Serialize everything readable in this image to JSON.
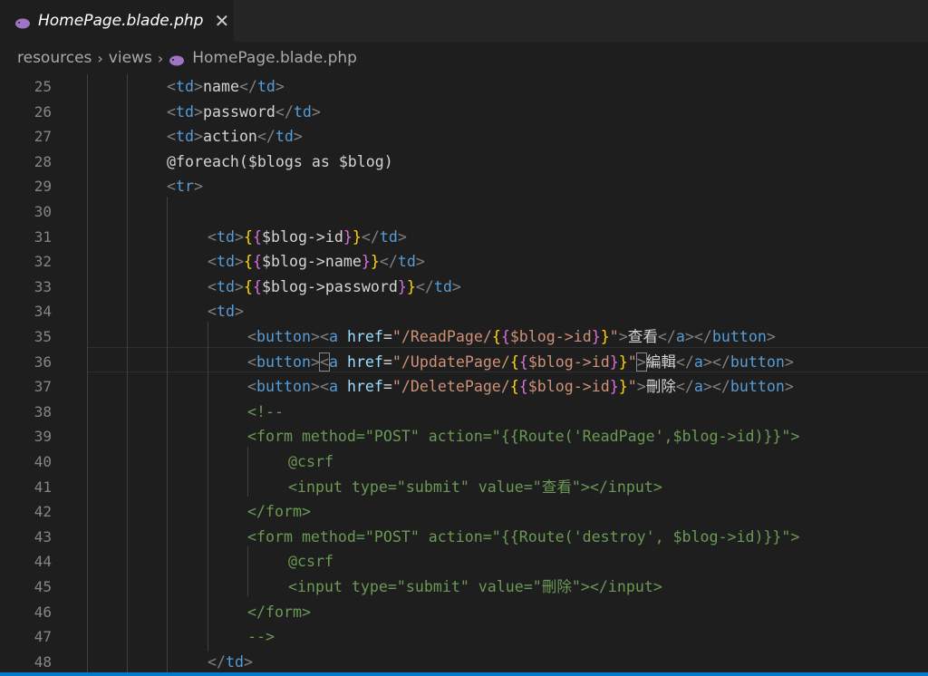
{
  "tab": {
    "title": "HomePage.blade.php",
    "icon": "php-elephant-icon",
    "close_icon": "close-icon",
    "close_glyph": "✕"
  },
  "breadcrumb": {
    "segments": [
      "resources",
      "views",
      "HomePage.blade.php"
    ],
    "separator": "›"
  },
  "colors": {
    "tag": "#569cd6",
    "attribute": "#9cdcfe",
    "string": "#ce9178",
    "comment": "#6a9955",
    "bracket_yellow": "#ffd700",
    "bracket_purple": "#da70d6",
    "line_number": "#858585",
    "background": "#1e1e1e"
  },
  "editor": {
    "lines": [
      {
        "n": "25"
      },
      {
        "n": "26"
      },
      {
        "n": "27"
      },
      {
        "n": "28"
      },
      {
        "n": "29"
      },
      {
        "n": "30"
      },
      {
        "n": "31"
      },
      {
        "n": "32"
      },
      {
        "n": "33"
      },
      {
        "n": "34"
      },
      {
        "n": "35"
      },
      {
        "n": "36"
      },
      {
        "n": "37"
      },
      {
        "n": "38"
      },
      {
        "n": "39"
      },
      {
        "n": "40"
      },
      {
        "n": "41"
      },
      {
        "n": "42"
      },
      {
        "n": "43"
      },
      {
        "n": "44"
      },
      {
        "n": "45"
      },
      {
        "n": "46"
      },
      {
        "n": "47"
      },
      {
        "n": "48"
      }
    ],
    "code": {
      "l25": "name",
      "l26": "password",
      "l27": "action",
      "l28": "@foreach($blogs as $blog)",
      "l31_expr": "$blog->id",
      "l32_expr": "$blog->name",
      "l33_expr": "$blog->password",
      "l35_href": "/ReadPage/",
      "l35_text": "查看",
      "l36_href": "/UpdatePage/",
      "l36_text": "編輯",
      "l37_href": "/DeletePage/",
      "l37_text": "刪除",
      "l38": "<!--",
      "l39": "<form method=\"POST\" action=\"{{Route('ReadPage',$blog->id)}}\">",
      "l40": "@csrf",
      "l41": "<input type=\"submit\" value=\"查看\"></input>",
      "l42": "</form>",
      "l43": "<form method=\"POST\" action=\"{{Route('destroy', $blog->id)}}\">",
      "l44": "@csrf",
      "l45": "<input type=\"submit\" value=\"刪除\"></input>",
      "l46": "</form>",
      "l47": "-->"
    }
  }
}
